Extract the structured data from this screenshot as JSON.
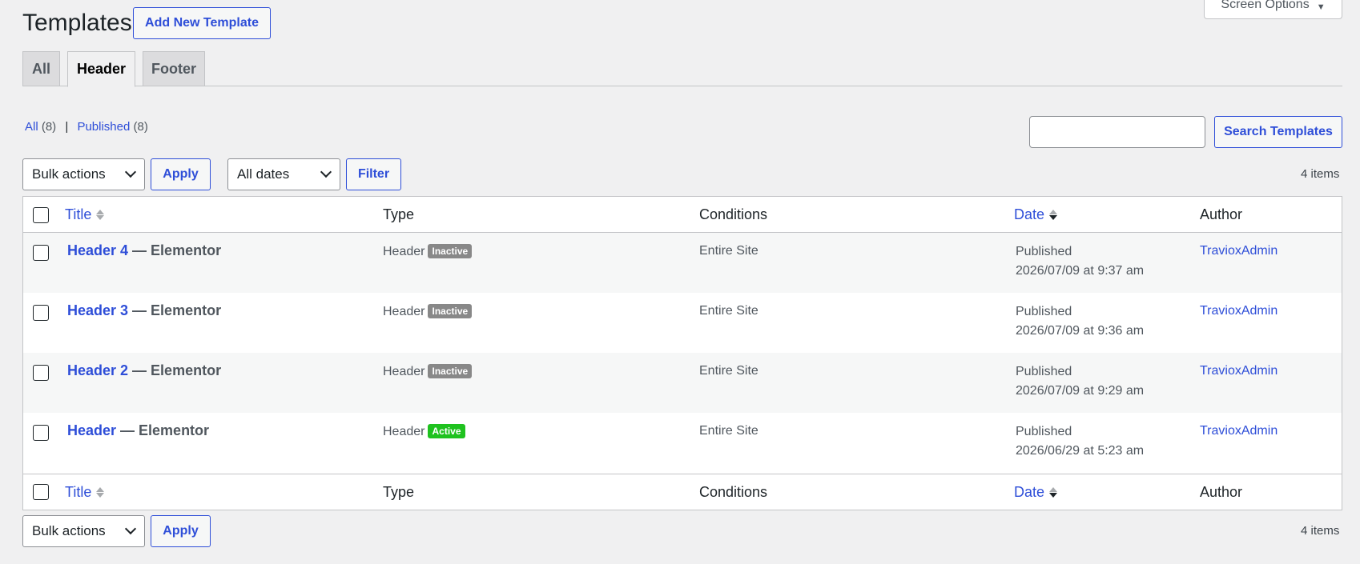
{
  "header": {
    "title": "Templates",
    "add_new_label": "Add New Template",
    "screen_options_label": "Screen Options"
  },
  "tabs": [
    {
      "label": "All",
      "active": false
    },
    {
      "label": "Header",
      "active": true
    },
    {
      "label": "Footer",
      "active": false
    }
  ],
  "filters_links": {
    "all_label": "All",
    "all_count": "(8)",
    "separator": "|",
    "published_label": "Published",
    "published_count": "(8)"
  },
  "search": {
    "placeholder": "",
    "button_label": "Search Templates"
  },
  "top_actions": {
    "bulk_selected": "Bulk actions",
    "apply_label": "Apply",
    "dates_selected": "All dates",
    "filter_label": "Filter",
    "items_count": "4 items"
  },
  "bottom_actions": {
    "bulk_selected": "Bulk actions",
    "apply_label": "Apply",
    "items_count": "4 items"
  },
  "table": {
    "columns": {
      "title": "Title",
      "type": "Type",
      "conditions": "Conditions",
      "date": "Date",
      "author": "Author"
    },
    "rows": [
      {
        "title": "Header 4",
        "suffix": " — Elementor",
        "type": "Header",
        "status_badge": "Inactive",
        "conditions": "Entire Site",
        "date_status": "Published",
        "date": "2026/07/09 at 9:37 am",
        "author": "TravioxAdmin"
      },
      {
        "title": "Header 3",
        "suffix": " — Elementor",
        "type": "Header",
        "status_badge": "Inactive",
        "conditions": "Entire Site",
        "date_status": "Published",
        "date": "2026/07/09 at 9:36 am",
        "author": "TravioxAdmin"
      },
      {
        "title": "Header 2",
        "suffix": " — Elementor",
        "type": "Header",
        "status_badge": "Inactive",
        "conditions": "Entire Site",
        "date_status": "Published",
        "date": "2026/07/09 at 9:29 am",
        "author": "TravioxAdmin"
      },
      {
        "title": "Header",
        "suffix": " — Elementor",
        "type": "Header",
        "status_badge": "Active",
        "conditions": "Entire Site",
        "date_status": "Published",
        "date": "2026/06/29 at 5:23 am",
        "author": "TravioxAdmin"
      }
    ]
  },
  "colors": {
    "accent": "#2e4ed8",
    "inactive_badge": "#888888",
    "active_badge": "#1fc21f",
    "background": "#f0f0f1"
  }
}
